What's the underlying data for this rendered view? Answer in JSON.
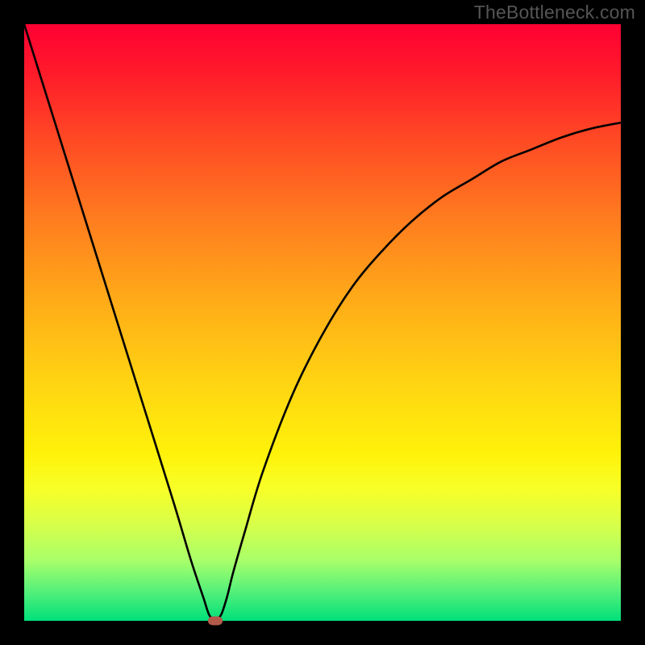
{
  "watermark": "TheBottleneck.com",
  "chart_data": {
    "type": "line",
    "title": "",
    "xlabel": "",
    "ylabel": "",
    "xlim": [
      0,
      100
    ],
    "ylim": [
      0,
      100
    ],
    "grid": false,
    "legend": false,
    "background_gradient": {
      "top": "#ff0033",
      "bottom": "#00e07a",
      "meaning": "red = high bottleneck, green = low bottleneck"
    },
    "series": [
      {
        "name": "bottleneck-curve",
        "color": "#000000",
        "x": [
          0,
          5,
          10,
          15,
          20,
          25,
          28,
          30,
          31,
          32,
          33,
          34,
          35,
          37,
          40,
          45,
          50,
          55,
          60,
          65,
          70,
          75,
          80,
          85,
          90,
          95,
          100
        ],
        "y": [
          100,
          84,
          68,
          52,
          36,
          20,
          10,
          4,
          1,
          0,
          1,
          4,
          8,
          15,
          25,
          38,
          48,
          56,
          62,
          67,
          71,
          74,
          77,
          79,
          81,
          82.5,
          83.5
        ]
      }
    ],
    "marker": {
      "name": "optimal-point",
      "x": 32,
      "y": 0,
      "color": "#b35a4a"
    }
  }
}
